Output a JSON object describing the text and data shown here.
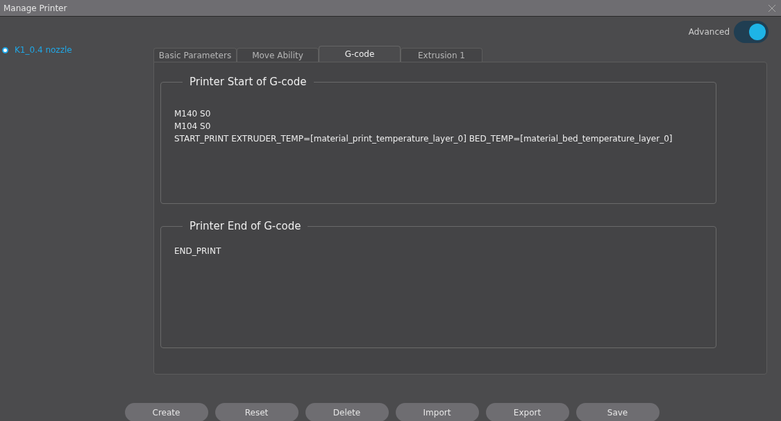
{
  "window": {
    "title": "Manage Printer"
  },
  "sidebar": {
    "items": [
      {
        "label": "K1_0.4 nozzle",
        "selected": true
      }
    ]
  },
  "advanced": {
    "label": "Advanced",
    "on": true
  },
  "tabs": [
    {
      "label": "Basic Parameters",
      "selected": false
    },
    {
      "label": "Move Ability",
      "selected": false
    },
    {
      "label": "G-code",
      "selected": true
    },
    {
      "label": "Extrusion 1",
      "selected": false
    }
  ],
  "groups": [
    {
      "title": "Printer Start of G-code",
      "lines": [
        "M140 S0",
        "M104 S0",
        "START_PRINT EXTRUDER_TEMP=[material_print_temperature_layer_0] BED_TEMP=[material_bed_temperature_layer_0]"
      ]
    },
    {
      "title": "Printer End of G-code",
      "lines": [
        "END_PRINT"
      ]
    }
  ],
  "buttons": [
    "Create",
    "Reset",
    "Delete",
    "Import",
    "Export",
    "Save"
  ]
}
